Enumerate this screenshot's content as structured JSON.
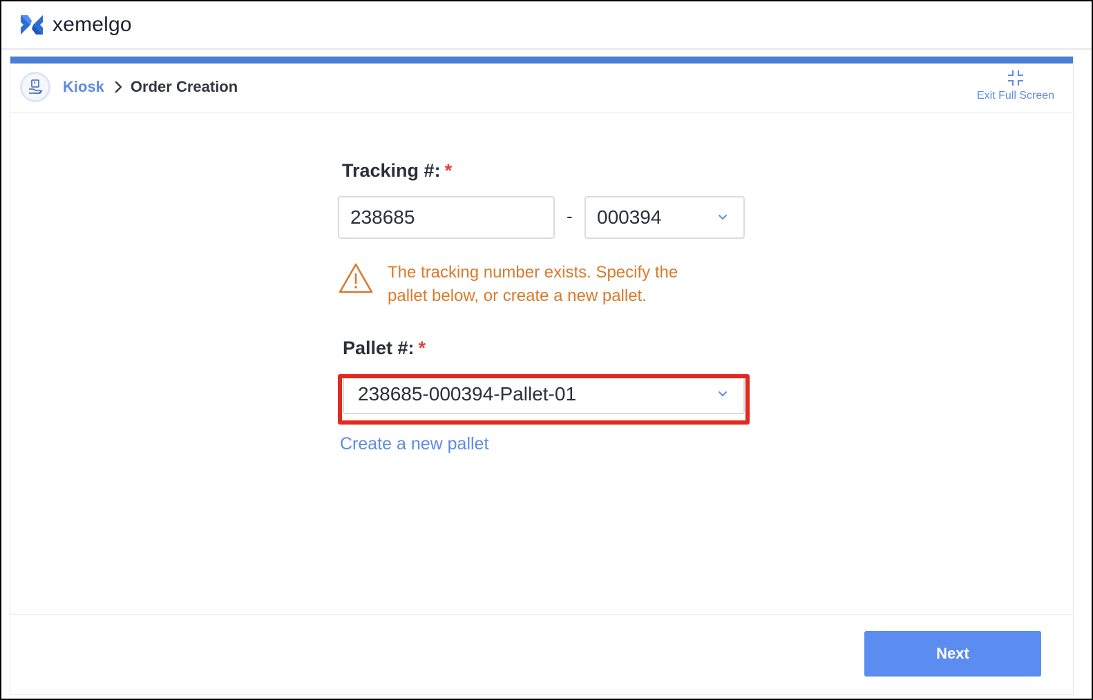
{
  "app": {
    "brand": "xemelgo"
  },
  "header": {
    "breadcrumb": [
      {
        "label": "Kiosk",
        "link": true
      },
      {
        "label": "Order Creation",
        "link": false
      }
    ],
    "exit_fullscreen_label": "Exit Full Screen"
  },
  "form": {
    "tracking": {
      "label": "Tracking #:",
      "required_mark": "*",
      "part1_value": "238685",
      "separator": "-",
      "part2_value": "000394"
    },
    "warning": {
      "line1": "The tracking number exists. Specify the",
      "line2": "pallet below, or create a new pallet."
    },
    "pallet": {
      "label": "Pallet #:",
      "required_mark": "*",
      "selected": "238685-000394-Pallet-01"
    },
    "create_pallet_link": "Create a new pallet"
  },
  "footer": {
    "next_label": "Next"
  },
  "colors": {
    "accent": "#4a7fd6",
    "link": "#5d8be6",
    "warning": "#d97a2c",
    "required": "#e04040",
    "highlight": "#e02a1f",
    "button": "#5b8df0"
  }
}
